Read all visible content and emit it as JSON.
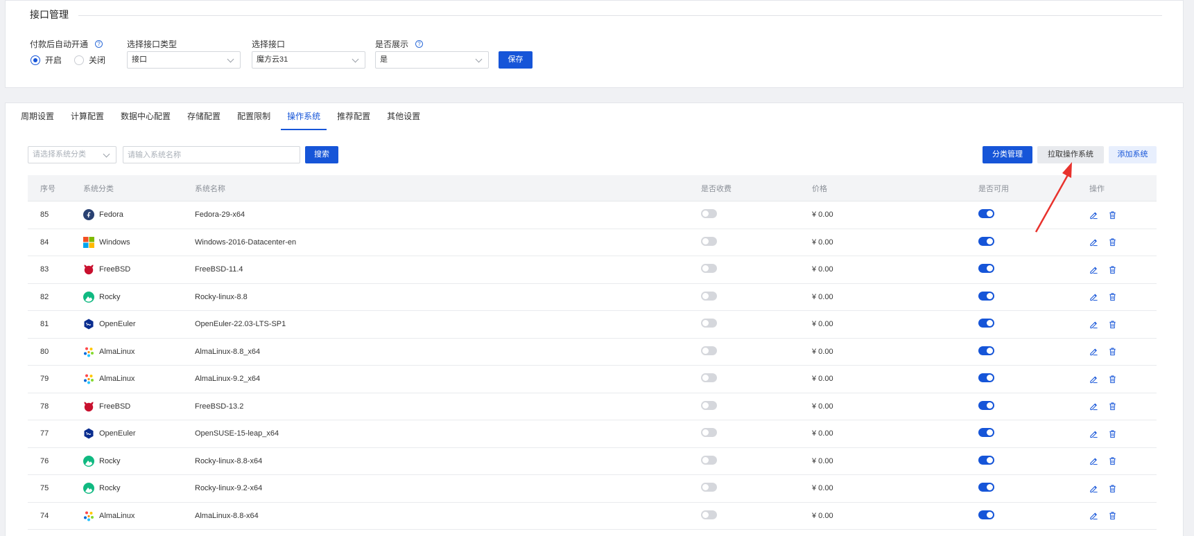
{
  "interface_section": {
    "title": "接口管理",
    "auto_open_label": "付款后自动开通",
    "auto_open_options": [
      "开启",
      "关闭"
    ],
    "auto_open_selected": "开启",
    "type_label": "选择接口类型",
    "type_value": "接口",
    "interface_label": "选择接口",
    "interface_value": "魔方云31",
    "display_label": "是否展示",
    "display_value": "是",
    "save_label": "保存",
    "help_glyph": "?"
  },
  "tabs": [
    "周期设置",
    "计算配置",
    "数据中心配置",
    "存储配置",
    "配置限制",
    "操作系统",
    "推荐配置",
    "其他设置"
  ],
  "active_tab": "操作系统",
  "toolbar": {
    "category_placeholder": "请选择系统分类",
    "search_placeholder": "请输入系统名称",
    "search_label": "搜索",
    "category_manage_label": "分类管理",
    "pull_os_label": "拉取操作系统",
    "add_os_label": "添加系统"
  },
  "table": {
    "headers": {
      "id": "序号",
      "category": "系统分类",
      "name": "系统名称",
      "charge": "是否收费",
      "price": "价格",
      "available": "是否可用",
      "actions": "操作"
    },
    "rows": [
      {
        "id": "85",
        "category": "Fedora",
        "icon": "fedora-icon",
        "name": "Fedora-29-x64",
        "charge": false,
        "price": "¥ 0.00",
        "available": true
      },
      {
        "id": "84",
        "category": "Windows",
        "icon": "windows-icon",
        "name": "Windows-2016-Datacenter-en",
        "charge": false,
        "price": "¥ 0.00",
        "available": true
      },
      {
        "id": "83",
        "category": "FreeBSD",
        "icon": "freebsd-icon",
        "name": "FreeBSD-11.4",
        "charge": false,
        "price": "¥ 0.00",
        "available": true
      },
      {
        "id": "82",
        "category": "Rocky",
        "icon": "rocky-icon",
        "name": "Rocky-linux-8.8",
        "charge": false,
        "price": "¥ 0.00",
        "available": true
      },
      {
        "id": "81",
        "category": "OpenEuler",
        "icon": "openeuler-icon",
        "name": "OpenEuler-22.03-LTS-SP1",
        "charge": false,
        "price": "¥ 0.00",
        "available": true
      },
      {
        "id": "80",
        "category": "AlmaLinux",
        "icon": "almalinux-icon",
        "name": "AlmaLinux-8.8_x64",
        "charge": false,
        "price": "¥ 0.00",
        "available": true
      },
      {
        "id": "79",
        "category": "AlmaLinux",
        "icon": "almalinux-icon",
        "name": "AlmaLinux-9.2_x64",
        "charge": false,
        "price": "¥ 0.00",
        "available": true
      },
      {
        "id": "78",
        "category": "FreeBSD",
        "icon": "freebsd-icon",
        "name": "FreeBSD-13.2",
        "charge": false,
        "price": "¥ 0.00",
        "available": true
      },
      {
        "id": "77",
        "category": "OpenEuler",
        "icon": "openeuler-icon",
        "name": "OpenSUSE-15-leap_x64",
        "charge": false,
        "price": "¥ 0.00",
        "available": true
      },
      {
        "id": "76",
        "category": "Rocky",
        "icon": "rocky-icon",
        "name": "Rocky-linux-8.8-x64",
        "charge": false,
        "price": "¥ 0.00",
        "available": true
      },
      {
        "id": "75",
        "category": "Rocky",
        "icon": "rocky-icon",
        "name": "Rocky-linux-9.2-x64",
        "charge": false,
        "price": "¥ 0.00",
        "available": true
      },
      {
        "id": "74",
        "category": "AlmaLinux",
        "icon": "almalinux-icon",
        "name": "AlmaLinux-8.8-x64",
        "charge": false,
        "price": "¥ 0.00",
        "available": true
      }
    ]
  },
  "colors": {
    "primary": "#1655d8",
    "annotation_arrow": "#e8322d",
    "fedora": "#294172",
    "freebsd": "#c8102e",
    "rocky": "#10b981",
    "openeuler": "#0a2d8f",
    "windows_red": "#f25022",
    "windows_green": "#7fba00",
    "windows_blue": "#00a4ef",
    "windows_yellow": "#ffb900"
  }
}
